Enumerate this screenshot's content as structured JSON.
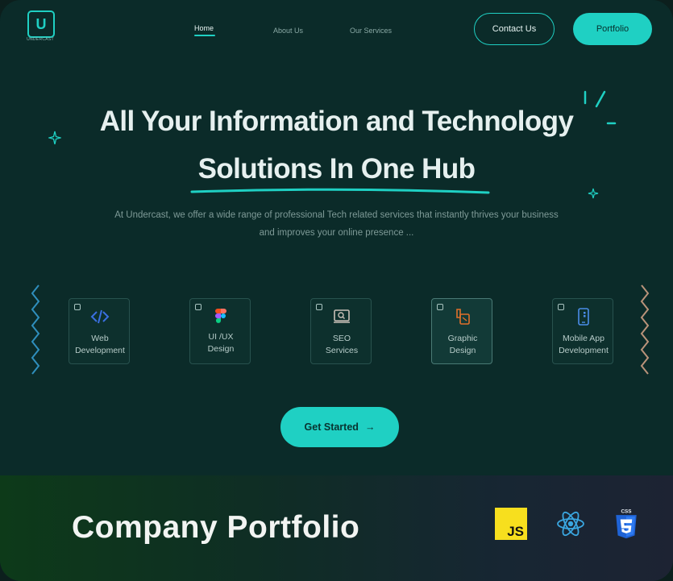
{
  "nav": {
    "logo_text": "UNDERCAST",
    "links": [
      "Home",
      "About Us",
      "Our Services"
    ],
    "contact_label": "Contact Us",
    "portfolio_label": "Portfolio"
  },
  "hero": {
    "headline_line1": "All Your Information and Technology",
    "headline_line2": "Solutions In One Hub",
    "subtitle": "At Undercast, we offer a wide range of professional Tech related services that instantly thrives your business and improves your online presence ...",
    "cta_label": "Get Started",
    "cta_arrow": "→"
  },
  "services": [
    {
      "label": "Web Development",
      "icon": "code-icon"
    },
    {
      "label": "UI /UX Design",
      "icon": "figma-icon"
    },
    {
      "label": "SEO Services",
      "icon": "monitor-search-icon"
    },
    {
      "label": "Graphic Design",
      "icon": "design-tools-icon"
    },
    {
      "label": "Mobile App Development",
      "icon": "mobile-icon"
    }
  ],
  "footer": {
    "title": "Company Portfolio",
    "tech_badges": [
      {
        "name": "javascript-icon",
        "text": "JS"
      },
      {
        "name": "react-icon",
        "text": ""
      },
      {
        "name": "css3-icon",
        "text": "CSS"
      }
    ]
  },
  "colors": {
    "accent": "#1fd0c3",
    "background": "#0b2b29",
    "text_light": "#e6f0ef"
  }
}
